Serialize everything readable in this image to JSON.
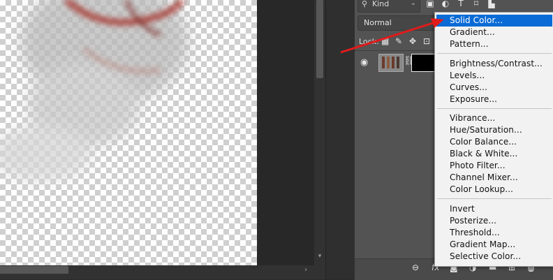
{
  "layers_panel": {
    "filter": {
      "kind_label": "Kind",
      "icons": [
        "image-filter-icon",
        "adjustment-filter-icon",
        "type-filter-icon",
        "shape-filter-icon",
        "smart-object-filter-icon"
      ]
    },
    "blend_mode": "Normal",
    "lock_label": "Lock:",
    "layer": {
      "visible": true
    },
    "bottom_icons": [
      "link-layers-icon",
      "fx-icon",
      "add-mask-icon",
      "new-adjustment-icon",
      "new-group-icon",
      "new-layer-icon",
      "delete-layer-icon"
    ]
  },
  "adjustment_menu": {
    "groups": [
      [
        "Solid Color...",
        "Gradient...",
        "Pattern..."
      ],
      [
        "Brightness/Contrast...",
        "Levels...",
        "Curves...",
        "Exposure..."
      ],
      [
        "Vibrance...",
        "Hue/Saturation...",
        "Color Balance...",
        "Black & White...",
        "Photo Filter...",
        "Channel Mixer...",
        "Color Lookup..."
      ],
      [
        "Invert",
        "Posterize...",
        "Threshold...",
        "Gradient Map...",
        "Selective Color..."
      ]
    ],
    "selected": "Solid Color..."
  },
  "colors": {
    "highlight": "#0a6bd6",
    "annotation_arrow": "#e01b1b",
    "panel": "#535353",
    "pasteboard": "#282828"
  },
  "icons": {
    "fx": "fx"
  }
}
